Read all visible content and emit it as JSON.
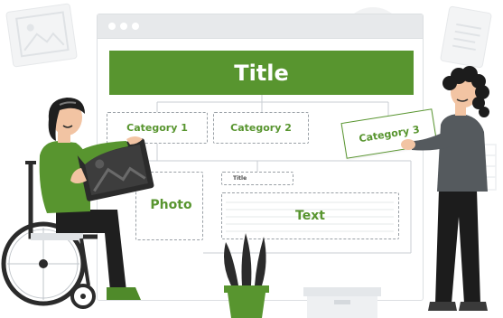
{
  "colors": {
    "accent": "#58952f",
    "dark": "#2b2b2b",
    "pot": "#58952f"
  },
  "wireframe": {
    "title": "Title",
    "category_1": "Category 1",
    "category_2": "Category 2",
    "category_3": "Category 3",
    "photo": "Photo",
    "small_title": "Title",
    "text": "Text"
  },
  "icons": [
    "image-icon",
    "document-icon",
    "wheelchair-icon",
    "plant-icon",
    "box-icon"
  ]
}
